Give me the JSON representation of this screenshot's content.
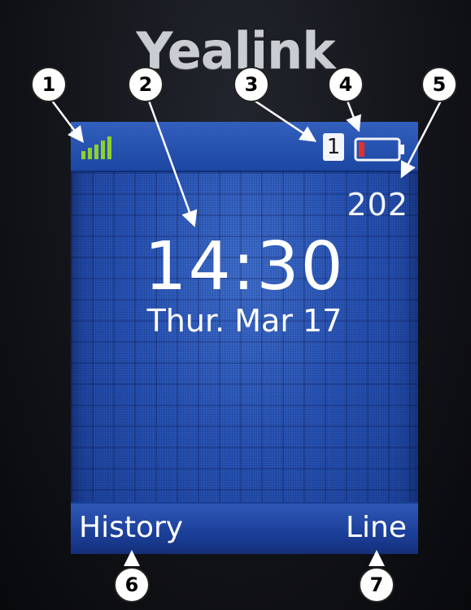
{
  "device": {
    "brand": "Yealink"
  },
  "status_bar": {
    "signal_icon": "signal-strength-icon",
    "signal_bars": 5,
    "line_indicator": "1",
    "battery_icon": "battery-low-icon",
    "battery_level_fraction": 0.15
  },
  "idle_screen": {
    "extension": "202",
    "time": "14:30",
    "date": "Thur. Mar 17"
  },
  "softkeys": {
    "left_label": "History",
    "right_label": "Line"
  },
  "callouts": [
    "1",
    "2",
    "3",
    "4",
    "5",
    "6",
    "7"
  ],
  "colors": {
    "screen_blue": "#2854b8",
    "signal_green": "#8ecf2f",
    "battery_red": "#e0332b",
    "text_white": "#ffffff"
  }
}
